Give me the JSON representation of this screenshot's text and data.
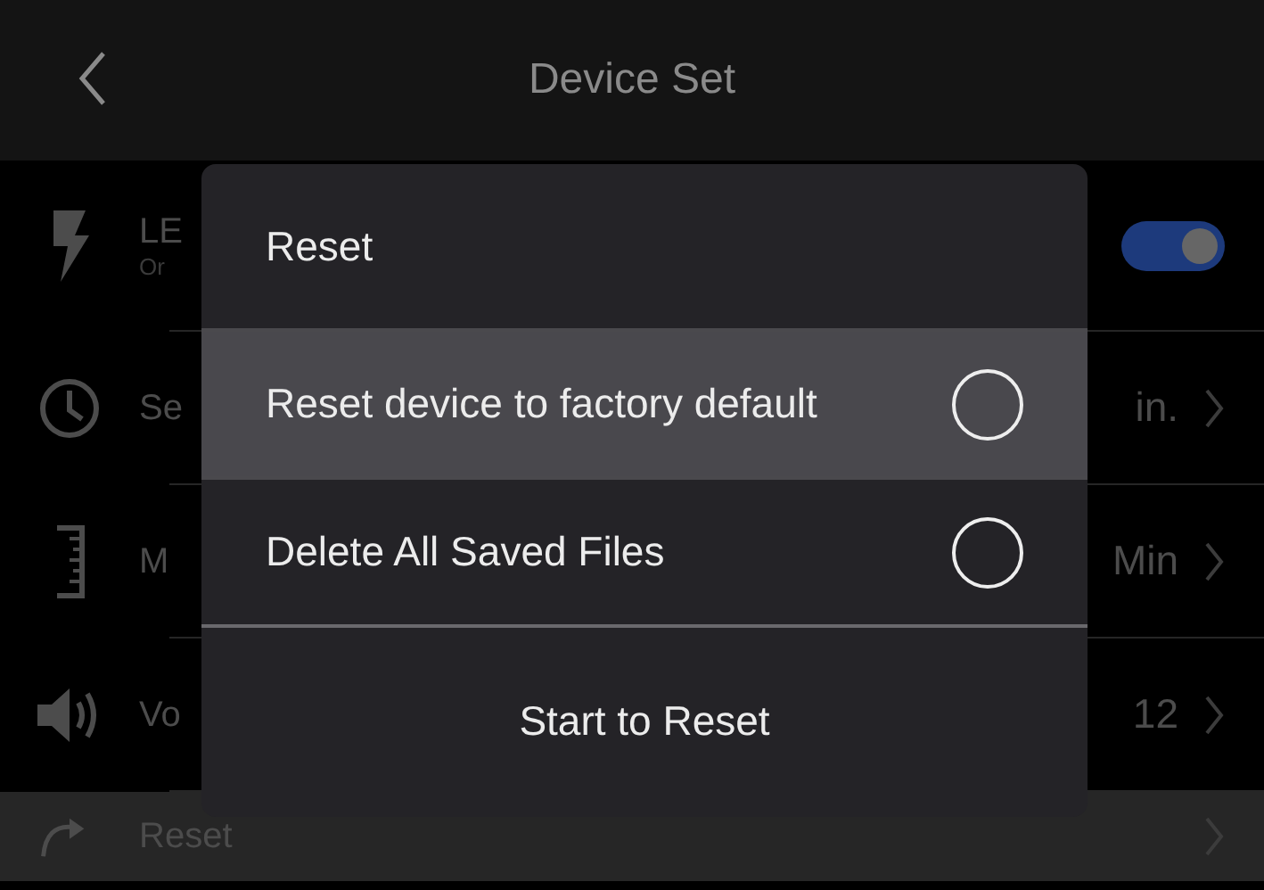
{
  "header": {
    "title": "Device Set"
  },
  "settings": [
    {
      "kind": "toggle",
      "title": "LE",
      "subtitle": "Or",
      "on": true,
      "selected": false
    },
    {
      "kind": "value",
      "title": "Se",
      "value": "in.",
      "selected": false
    },
    {
      "kind": "value",
      "title": "M",
      "value": "Min",
      "selected": false
    },
    {
      "kind": "value",
      "title": "Vo",
      "value": "12",
      "selected": false
    },
    {
      "kind": "link",
      "title": "Reset",
      "selected": true
    }
  ],
  "dialog": {
    "title": "Reset",
    "options": [
      {
        "label": "Reset device to factory default",
        "selected": true,
        "checked": false
      },
      {
        "label": "Delete All Saved Files",
        "selected": false,
        "checked": false
      }
    ],
    "action": "Start to Reset"
  }
}
